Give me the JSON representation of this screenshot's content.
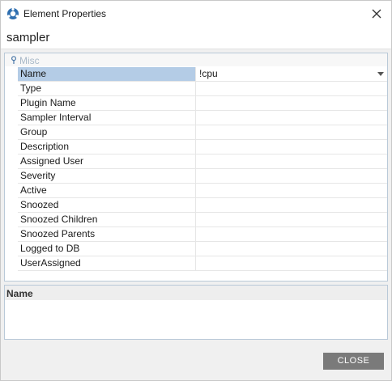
{
  "window": {
    "title": "Element Properties"
  },
  "element": {
    "name": "sampler"
  },
  "grid": {
    "category": "Misc",
    "properties": [
      {
        "name": "Name",
        "value": "!cpu",
        "selected": true
      },
      {
        "name": "Type",
        "value": ""
      },
      {
        "name": "Plugin Name",
        "value": ""
      },
      {
        "name": "Sampler Interval",
        "value": ""
      },
      {
        "name": "Group",
        "value": ""
      },
      {
        "name": "Description",
        "value": ""
      },
      {
        "name": "Assigned User",
        "value": ""
      },
      {
        "name": "Severity",
        "value": ""
      },
      {
        "name": "Active",
        "value": ""
      },
      {
        "name": "Snoozed",
        "value": ""
      },
      {
        "name": "Snoozed Children",
        "value": ""
      },
      {
        "name": "Snoozed Parents",
        "value": ""
      },
      {
        "name": "Logged to DB",
        "value": ""
      },
      {
        "name": "UserAssigned",
        "value": ""
      }
    ]
  },
  "description": {
    "title": "Name",
    "text": ""
  },
  "footer": {
    "close_label": "CLOSE"
  },
  "icons": {
    "app": "app-icon",
    "close": "close-icon",
    "category": "category-pin-icon",
    "dropdown": "chevron-down-icon"
  }
}
